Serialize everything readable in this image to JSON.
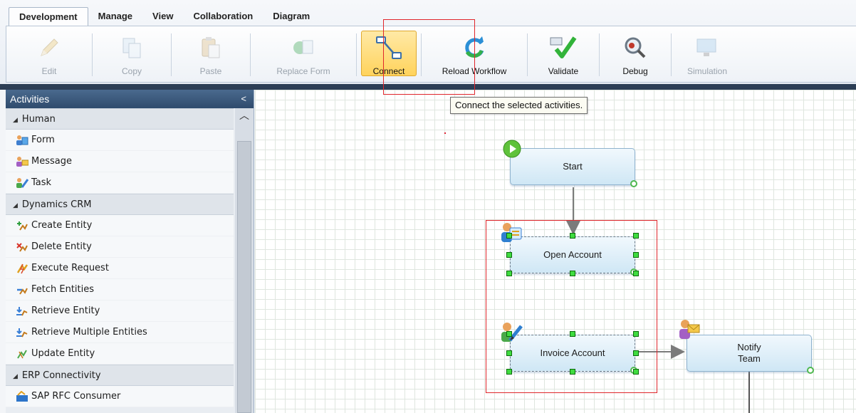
{
  "ribbon": {
    "tabs": [
      {
        "label": "Development",
        "active": true
      },
      {
        "label": "Manage"
      },
      {
        "label": "View"
      },
      {
        "label": "Collaboration"
      },
      {
        "label": "Diagram"
      }
    ],
    "buttons": {
      "edit": "Edit",
      "copy": "Copy",
      "paste": "Paste",
      "replace_form": "Replace Form",
      "connect": "Connect",
      "reload_workflow": "Reload Workflow",
      "validate": "Validate",
      "debug": "Debug",
      "simulation": "Simulation"
    }
  },
  "tooltip": "Connect the selected activities.",
  "panel": {
    "title": "Activities",
    "collapse_glyph": "<",
    "groups": [
      {
        "label": "Human",
        "items": [
          "Form",
          "Message",
          "Task"
        ]
      },
      {
        "label": "Dynamics CRM",
        "items": [
          "Create Entity",
          "Delete Entity",
          "Execute Request",
          "Fetch Entities",
          "Retrieve Entity",
          "Retrieve Multiple Entities",
          "Update Entity"
        ]
      },
      {
        "label": "ERP Connectivity",
        "items": [
          "SAP RFC Consumer"
        ]
      }
    ]
  },
  "workflow": {
    "start": "Start",
    "open_account": "Open Account",
    "invoice_account": "Invoice Account",
    "notify_team_line1": "Notify",
    "notify_team_line2": "Team"
  },
  "colors": {
    "accent": "#2f4b6d",
    "selection_handle": "#3fdc3f",
    "highlight": "#e0262b",
    "active_button": "#ffd35c"
  }
}
